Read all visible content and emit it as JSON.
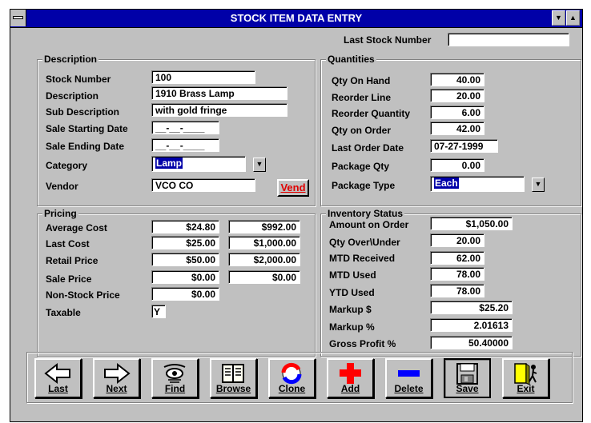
{
  "window": {
    "title": "STOCK ITEM DATA ENTRY"
  },
  "header": {
    "last_stock_label": "Last Stock Number",
    "last_stock_value": ""
  },
  "description": {
    "title": "Description",
    "stock_number_label": "Stock Number",
    "stock_number": "100",
    "description_label": "Description",
    "description": "1910 Brass Lamp",
    "sub_description_label": "Sub Description",
    "sub_description": "with gold fringe",
    "sale_start_label": "Sale Starting Date",
    "sale_start": "__-__-____",
    "sale_end_label": "Sale Ending Date",
    "sale_end": "__-__-____",
    "category_label": "Category",
    "category": "Lamp",
    "vendor_label": "Vendor",
    "vendor": "VCO CO",
    "vend_button": "Vend"
  },
  "quantities": {
    "title": "Quantities",
    "rows": [
      {
        "label": "Qty On Hand",
        "value": "40.00"
      },
      {
        "label": "Reorder Line",
        "value": "20.00"
      },
      {
        "label": "Reorder Quantity",
        "value": "6.00"
      },
      {
        "label": "Qty on Order",
        "value": "42.00"
      },
      {
        "label": "Last Order Date",
        "value": "07-27-1999"
      },
      {
        "label": "Package Qty",
        "value": "0.00"
      }
    ],
    "package_type_label": "Package Type",
    "package_type": "Each"
  },
  "pricing": {
    "title": "Pricing",
    "rows": [
      {
        "label": "Average Cost",
        "v1": "$24.80",
        "v2": "$992.00"
      },
      {
        "label": "Last Cost",
        "v1": "$25.00",
        "v2": "$1,000.00"
      },
      {
        "label": "Retail Price",
        "v1": "$50.00",
        "v2": "$2,000.00"
      },
      {
        "label": "Sale Price",
        "v1": "$0.00",
        "v2": "$0.00"
      },
      {
        "label": "Non-Stock Price",
        "v1": "$0.00"
      }
    ],
    "taxable_label": "Taxable",
    "taxable": "Y"
  },
  "inventory": {
    "title": "Inventory Status",
    "rows": [
      {
        "label": "Amount on Order",
        "value": "$1,050.00"
      },
      {
        "label": "Qty Over\\Under",
        "value": "20.00"
      },
      {
        "label": "MTD Received",
        "value": "62.00"
      },
      {
        "label": "MTD Used",
        "value": "78.00"
      },
      {
        "label": "YTD Used",
        "value": "78.00"
      },
      {
        "label": "Markup $",
        "value": "$25.20"
      },
      {
        "label": "Markup %",
        "value": "2.01613"
      },
      {
        "label": "Gross Profit %",
        "value": "50.40000"
      }
    ]
  },
  "toolbar": {
    "last": "Last",
    "next": "Next",
    "find": "Find",
    "browse": "Browse",
    "clone": "Clone",
    "add": "Add",
    "delete": "Delete",
    "save": "Save",
    "exit": "Exit"
  },
  "icons": {
    "last": "arrow-left-icon",
    "next": "arrow-right-icon",
    "find": "eye-icon",
    "browse": "book-icon",
    "clone": "clone-icon",
    "add": "plus-icon",
    "delete": "minus-icon",
    "save": "floppy-icon",
    "exit": "exit-door-icon"
  },
  "colors": {
    "title_bar": "#0000a8",
    "face": "#c0c0c0",
    "add": "#ff0000",
    "delete": "#0000ff",
    "vend_text": "#e00000"
  }
}
